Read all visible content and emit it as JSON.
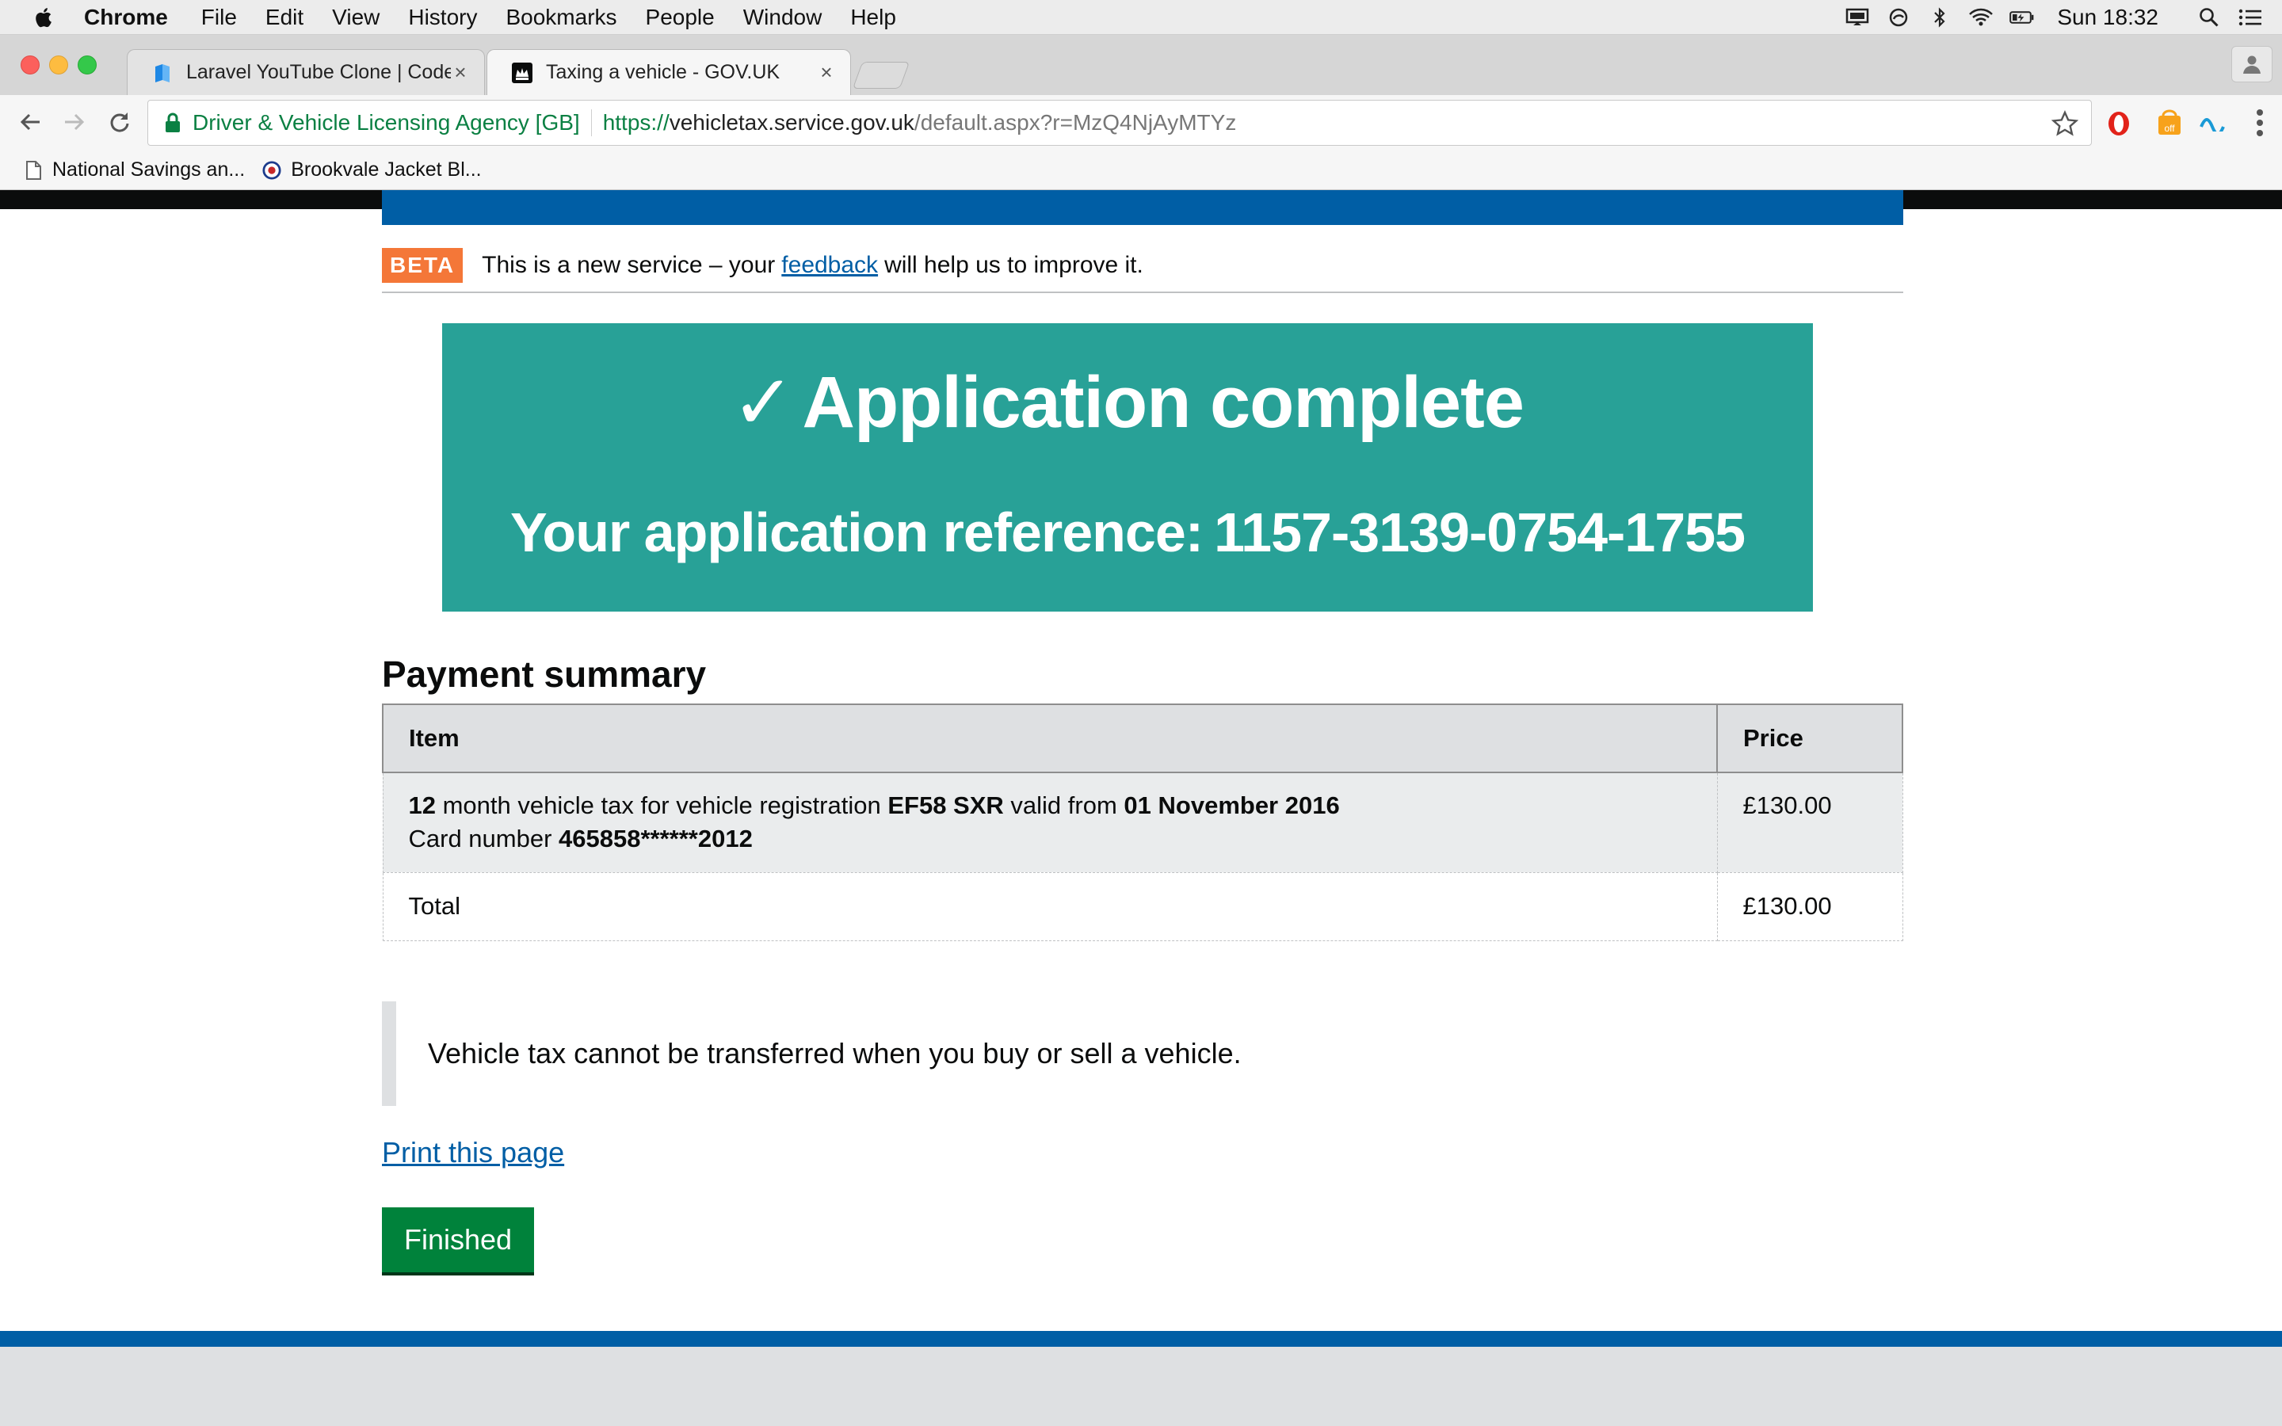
{
  "menubar": {
    "app": "Chrome",
    "items": [
      "File",
      "Edit",
      "View",
      "History",
      "Bookmarks",
      "People",
      "Window",
      "Help"
    ],
    "clock": "Sun 18:32",
    "status_icons": [
      "screen-mirror-icon",
      "sync-icon",
      "bluetooth-icon",
      "wifi-icon",
      "battery-icon",
      "spotlight-search-icon",
      "notification-center-icon"
    ]
  },
  "tabs": [
    {
      "title": "Laravel YouTube Clone | Coder",
      "favicon": "book-icon",
      "active": false
    },
    {
      "title": "Taxing a vehicle - GOV.UK",
      "favicon": "crown-icon",
      "active": true
    }
  ],
  "omnibox": {
    "org": "Driver & Vehicle Licensing Agency [GB]",
    "scheme": "https://",
    "host": "vehicletax.service.gov.uk",
    "path": "/default.aspx?r=MzQ4NjAyMTYz"
  },
  "extensions": {
    "badge": "off"
  },
  "bookmarks": [
    {
      "label": "National Savings an...",
      "icon": "page-icon"
    },
    {
      "label": "Brookvale Jacket Bl...",
      "icon": "site-icon"
    }
  ],
  "page": {
    "beta": {
      "tag": "BETA",
      "text_before": "This is a new service – your",
      "link": "feedback",
      "text_after": "will help us to improve it."
    },
    "confirmation": {
      "check": "✓",
      "title": "Application complete",
      "ref_label": "Your application reference:",
      "ref_value": "1157-3139-0754-1755"
    },
    "summary": {
      "heading": "Payment summary",
      "columns": [
        "Item",
        "Price"
      ],
      "item": {
        "months": "12",
        "text_months": "month vehicle tax for vehicle registration",
        "registration": "EF58 SXR",
        "text_valid": "valid from",
        "valid_from": "01 November 2016",
        "card_label": "Card number",
        "card_number": "465858******2012",
        "price": "£130.00"
      },
      "total": {
        "label": "Total",
        "price": "£130.00"
      }
    },
    "notice": "Vehicle tax cannot be transferred when you buy or sell a vehicle.",
    "print_link": "Print this page",
    "finished_button": "Finished"
  },
  "colors": {
    "govuk_blue": "#005ea5",
    "beta_orange": "#f47738",
    "panel_turquoise": "#28a197",
    "button_green": "#00823b",
    "link": "#005ea5"
  }
}
